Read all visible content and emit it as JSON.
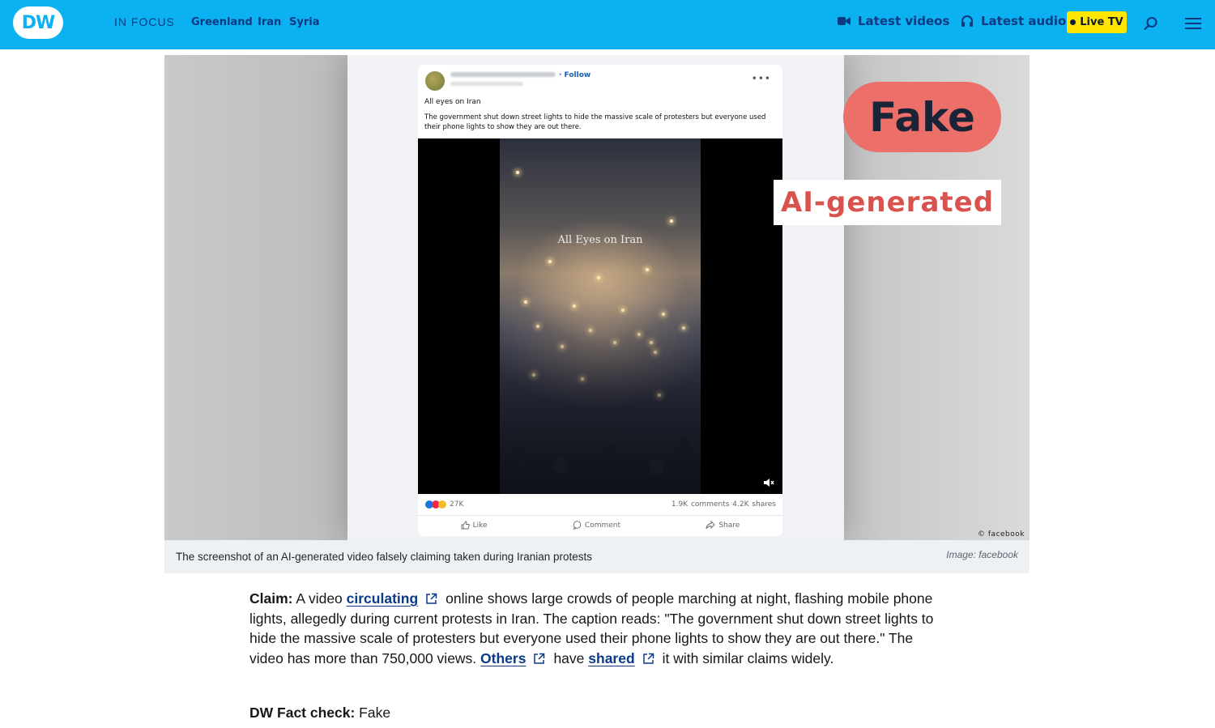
{
  "header": {
    "logo_text": "DW",
    "in_focus_label": "IN FOCUS",
    "focus_links": [
      "Greenland",
      "Iran",
      "Syria"
    ],
    "latest_videos": "Latest videos",
    "latest_audio": "Latest audio",
    "live_tv": "Live TV",
    "colors": {
      "bar": "#0bb1f1",
      "live": "#ffe500",
      "nav_text": "#0c3a82"
    }
  },
  "figure": {
    "post": {
      "follow": "· Follow",
      "title": "All eyes on Iran",
      "caption": "The government shut down street lights to hide the massive scale of protesters but everyone used their phone lights to show they are out there.",
      "video_text": "All Eyes on Iran",
      "reactions_count": "27K",
      "counts": "1.9K comments   4.2K shares",
      "actions": [
        "Like",
        "Comment",
        "Share"
      ]
    },
    "tag_fake": "Fake",
    "tag_ai": "AI-generated",
    "copyright": "© facebook",
    "caption": "The screenshot of an AI-generated video falsely claiming taken during Iranian protests",
    "credit": "Image: facebook"
  },
  "article": {
    "claim_label": "Claim:",
    "claim_text_1": " A video ",
    "link_circulating": "circulating",
    "claim_text_2": "online shows large crowds of people marching at night, flashing mobile phone lights, allegedly during current protests in Iran.  The caption reads: \"The government shut down street lights to hide the massive scale of protesters but everyone used their phone lights to show they are out there.\" The video has more than 750,000 views. ",
    "link_others": "Others",
    "claim_text_3": "have ",
    "link_shared": "shared",
    "claim_text_4": "it with similar claims widely.",
    "verdict_label": "DW Fact check:",
    "verdict_value": " Fake"
  }
}
